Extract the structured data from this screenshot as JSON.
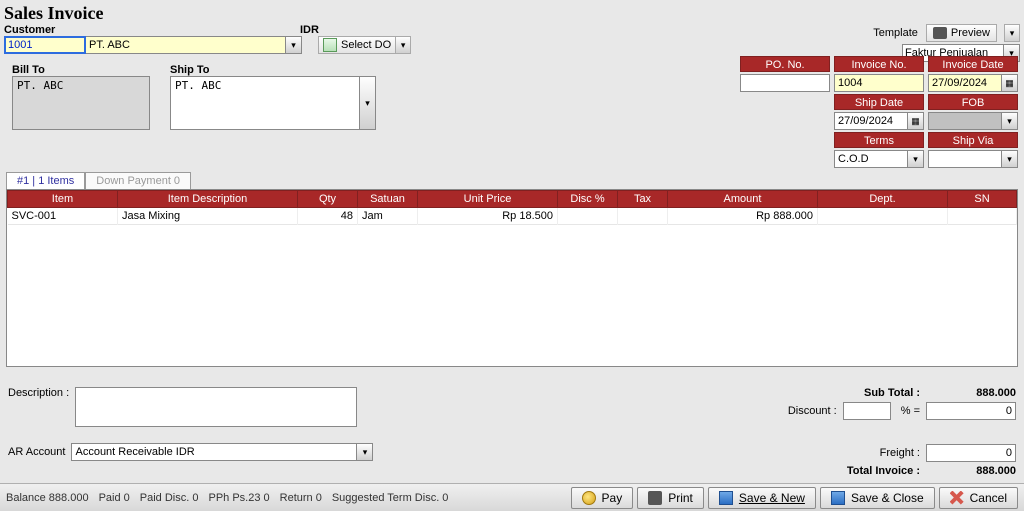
{
  "title": "Sales Invoice",
  "labels": {
    "customer": "Customer",
    "idr": "IDR",
    "select_do": "Select DO",
    "bill_to": "Bill To",
    "ship_to": "Ship To",
    "template": "Template",
    "preview": "Preview",
    "description": "Description :",
    "ar_account": "AR Account"
  },
  "customer": {
    "code": "1001",
    "name": "PT. ABC"
  },
  "template_select": "Faktur Penjualan",
  "bill_to": "PT. ABC",
  "ship_to": "PT. ABC",
  "header_fields": {
    "po_no": {
      "label": "PO. No.",
      "value": ""
    },
    "invoice_no": {
      "label": "Invoice No.",
      "value": "1004"
    },
    "invoice_date": {
      "label": "Invoice Date",
      "value": "27/09/2024"
    },
    "ship_date": {
      "label": "Ship Date",
      "value": "27/09/2024"
    },
    "fob": {
      "label": "FOB",
      "value": ""
    },
    "terms": {
      "label": "Terms",
      "value": "C.O.D"
    },
    "ship_via": {
      "label": "Ship Via",
      "value": ""
    }
  },
  "tabs": {
    "items": "#1 | 1 Items",
    "down_payment": "Down Payment   0"
  },
  "grid": {
    "columns": [
      "Item",
      "Item Description",
      "Qty",
      "Satuan",
      "Unit Price",
      "Disc %",
      "Tax",
      "Amount",
      "Dept.",
      "SN"
    ],
    "rows": [
      {
        "item": "SVC-001",
        "desc": "Jasa Mixing",
        "qty": "48",
        "satuan": "Jam",
        "unit_price": "Rp 18.500",
        "disc": "",
        "tax": "",
        "amount": "Rp 888.000",
        "dept": "",
        "sn": ""
      }
    ]
  },
  "ar_account": "Account Receivable IDR",
  "totals": {
    "subtotal_label": "Sub Total :",
    "subtotal": "888.000",
    "discount_label": "Discount :",
    "discount_pct": "",
    "pct_sign": "% =",
    "discount_amt": "0",
    "freight_label": "Freight :",
    "freight": "0",
    "total_label": "Total Invoice :",
    "total": "888.000"
  },
  "status": {
    "balance": "Balance 888.000",
    "paid": "Paid 0",
    "paid_disc": "Paid Disc. 0",
    "pph": "PPh Ps.23 0",
    "return": "Return 0",
    "suggested": "Suggested Term Disc. 0"
  },
  "buttons": {
    "pay": "Pay",
    "print": "Print",
    "save_new": "Save & New",
    "save_close": "Save & Close",
    "cancel": "Cancel"
  }
}
